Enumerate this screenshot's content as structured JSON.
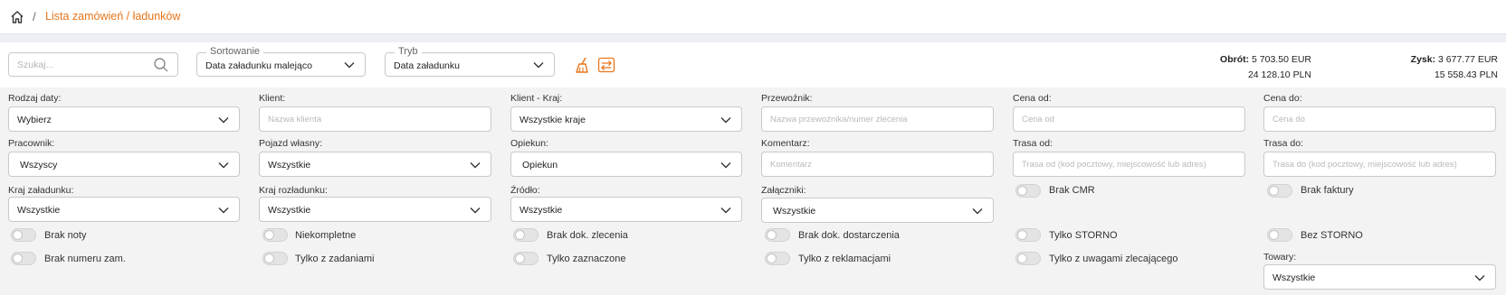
{
  "breadcrumb": {
    "current": "Lista zamówień / ładunków"
  },
  "search": {
    "placeholder": "Szukaj..."
  },
  "sorting": {
    "legend": "Sortowanie",
    "value": "Data załadunku malejąco"
  },
  "mode": {
    "legend": "Tryb",
    "value": "Data załadunku"
  },
  "totals": {
    "turnover_label": "Obrót:",
    "turnover_eur": "5 703.50 EUR",
    "turnover_pln": "24 128.10 PLN",
    "profit_label": "Zysk:",
    "profit_eur": "3 677.77 EUR",
    "profit_pln": "15 558.43 PLN"
  },
  "filters": {
    "date_type": {
      "label": "Rodzaj daty:",
      "value": "Wybierz"
    },
    "client": {
      "label": "Klient:",
      "placeholder": "Nazwa klienta"
    },
    "client_country": {
      "label": "Klient - Kraj:",
      "value": "Wszystkie kraje"
    },
    "carrier": {
      "label": "Przewoźnik:",
      "placeholder": "Nazwa przewoźnika/numer zlecenia"
    },
    "price_from": {
      "label": "Cena od:",
      "placeholder": "Cena od"
    },
    "price_to": {
      "label": "Cena do:",
      "placeholder": "Cena do"
    },
    "employee": {
      "label": "Pracownik:",
      "value": "Wszyscy"
    },
    "own_vehicle": {
      "label": "Pojazd własny:",
      "value": "Wszystkie"
    },
    "supervisor": {
      "label": "Opiekun:",
      "value": "Opiekun"
    },
    "comment": {
      "label": "Komentarz:",
      "placeholder": "Komentarz"
    },
    "route_from": {
      "label": "Trasa od:",
      "placeholder": "Trasa od (kod pocztowy, miejscowość lub adres)"
    },
    "route_to": {
      "label": "Trasa do:",
      "placeholder": "Trasa do (kod pocztowy, miejscowość lub adres)"
    },
    "loading_country": {
      "label": "Kraj załadunku:",
      "value": "Wszystkie"
    },
    "unloading_country": {
      "label": "Kraj rozładunku:",
      "value": "Wszystkie"
    },
    "source": {
      "label": "Źródło:",
      "value": "Wszystkie"
    },
    "attachments": {
      "label": "Załączniki:",
      "value": "Wszystkie"
    },
    "goods": {
      "label": "Towary:",
      "value": "Wszystkie"
    }
  },
  "toggles": {
    "no_cmr": "Brak CMR",
    "no_invoice": "Brak faktury",
    "no_note": "Brak noty",
    "incomplete": "Niekompletne",
    "no_order_doc": "Brak dok. zlecenia",
    "no_delivery_doc": "Brak dok. dostarczenia",
    "only_storno": "Tylko STORNO",
    "without_storno": "Bez STORNO",
    "no_order_number": "Brak numeru zam.",
    "only_with_tasks": "Tylko z zadaniami",
    "only_marked": "Tylko zaznaczone",
    "only_with_complaints": "Tylko z reklamacjami",
    "only_with_client_remarks": "Tylko z uwagami zlecającego"
  },
  "colors": {
    "accent": "#e8751a",
    "background": "#f3f3f3"
  },
  "icons": {
    "home": "home-icon",
    "search": "search-icon",
    "broom": "broom-icon",
    "swap": "swap-icon",
    "chevron": "chevron-down-icon"
  }
}
